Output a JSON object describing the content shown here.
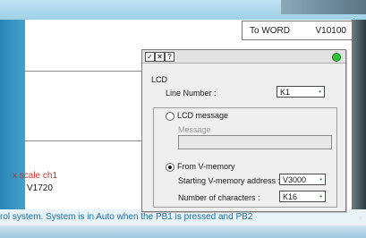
{
  "background": {
    "word_box": {
      "label": "To WORD",
      "address": "V10100"
    },
    "red_text": "x scale ch1",
    "black_text": "V1720",
    "status_text": "rol system. System is in Auto when the PB1 is pressed and PB2"
  },
  "dialog": {
    "title_buttons": {
      "check": "✓",
      "close": "✕",
      "help": "?"
    },
    "group_title": "LCD",
    "line_number_label": "Line Number :",
    "line_number_value": "K1",
    "radio_lcd_message": "LCD message",
    "message_label": "Message",
    "radio_from_vmemory": "From V-memory",
    "starting_address_label": "Starting V-memory address :",
    "starting_address_value": "V3000",
    "num_chars_label": "Number of characters :",
    "num_chars_value": "K16",
    "selected_source": "From V-memory"
  },
  "colors": {
    "accent_blue": "#2f8fbd",
    "status_green": "#2fbf3a",
    "red_label": "#c8392b",
    "status_text": "#1a6fa3"
  }
}
